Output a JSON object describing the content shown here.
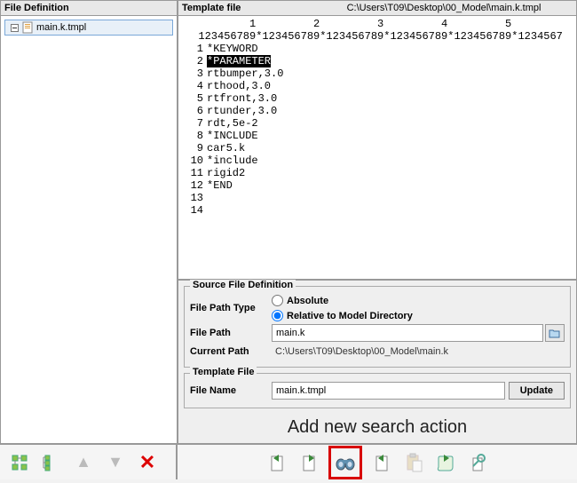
{
  "left_panel": {
    "title": "File Definition",
    "tree_item": "main.k.tmpl"
  },
  "template_header": {
    "label": "Template file",
    "path": "C:\\Users\\T09\\Desktop\\00_Model\\main.k.tmpl"
  },
  "ruler": {
    "tens": "          1         2         3         4         5",
    "ones": "  123456789*123456789*123456789*123456789*123456789*1234567"
  },
  "code_lines": [
    {
      "n": "1",
      "t": "*KEYWORD"
    },
    {
      "n": "2",
      "t": "*PARAMETER",
      "hl": true
    },
    {
      "n": "3",
      "t": "rtbumper,3.0"
    },
    {
      "n": "4",
      "t": "rthood,3.0"
    },
    {
      "n": "5",
      "t": "rtfront,3.0"
    },
    {
      "n": "6",
      "t": "rtunder,3.0"
    },
    {
      "n": "7",
      "t": "rdt,5e-2"
    },
    {
      "n": "8",
      "t": "*INCLUDE"
    },
    {
      "n": "9",
      "t": "car5.k"
    },
    {
      "n": "10",
      "t": "*include"
    },
    {
      "n": "11",
      "t": "rigid2"
    },
    {
      "n": "12",
      "t": "*END"
    },
    {
      "n": "13",
      "t": ""
    },
    {
      "n": "14",
      "t": ""
    }
  ],
  "source_def": {
    "legend": "Source File Definition",
    "file_path_type_label": "File Path Type",
    "absolute_label": "Absolute",
    "relative_label": "Relative to Model Directory",
    "file_path_label": "File Path",
    "file_path_value": "main.k",
    "current_path_label": "Current Path",
    "current_path_value": "C:\\Users\\T09\\Desktop\\00_Model\\main.k"
  },
  "template_file": {
    "legend": "Template File",
    "file_name_label": "File Name",
    "file_name_value": "main.k.tmpl",
    "update_label": "Update"
  },
  "help_text": "Add new search action"
}
